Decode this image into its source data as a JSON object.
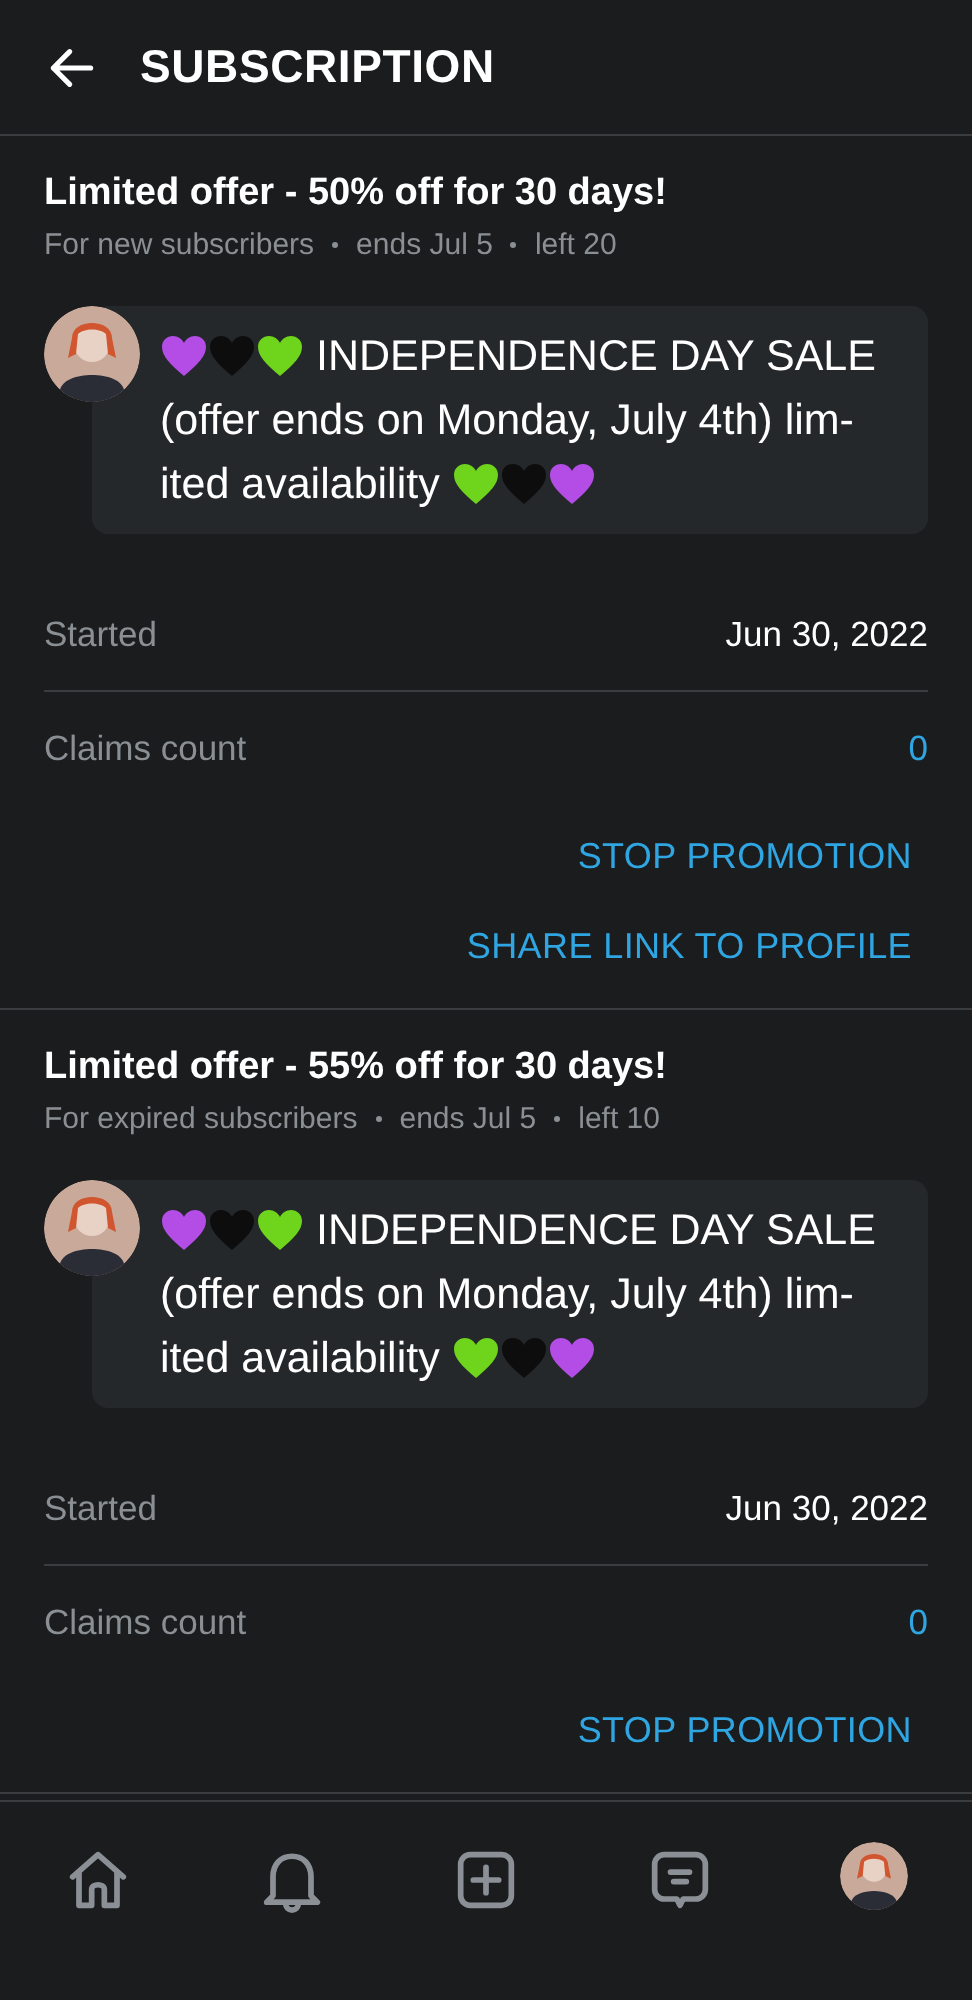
{
  "header": {
    "title": "SUBSCRIPTION"
  },
  "offers": [
    {
      "title": "Limited offer - 50% off for 30 days!",
      "meta": [
        "For new subscribers",
        "ends Jul 5",
        "left 20"
      ],
      "message": {
        "lead_hearts": [
          {
            "color": "#b34de6"
          },
          {
            "color": "#0d0d0d"
          },
          {
            "color": "#6fd41c"
          }
        ],
        "text": "INDEPENDENCE DAY SALE (offer ends on Monday, July 4th) lim-ited availability",
        "trail_hearts": [
          {
            "color": "#6fd41c"
          },
          {
            "color": "#0d0d0d"
          },
          {
            "color": "#b34de6"
          }
        ]
      },
      "rows": [
        {
          "label": "Started",
          "value": "Jun 30, 2022",
          "kind": "plain"
        },
        {
          "label": "Claims count",
          "value": "0",
          "kind": "link"
        }
      ],
      "actions": [
        "STOP PROMOTION",
        "SHARE LINK TO PROFILE"
      ]
    },
    {
      "title": "Limited offer - 55% off for 30 days!",
      "meta": [
        "For expired subscribers",
        "ends Jul 5",
        "left 10"
      ],
      "message": {
        "lead_hearts": [
          {
            "color": "#b34de6"
          },
          {
            "color": "#0d0d0d"
          },
          {
            "color": "#6fd41c"
          }
        ],
        "text": "INDEPENDENCE DAY SALE (offer ends on Monday, July 4th) lim-ited availability",
        "trail_hearts": [
          {
            "color": "#6fd41c"
          },
          {
            "color": "#0d0d0d"
          },
          {
            "color": "#b34de6"
          }
        ]
      },
      "rows": [
        {
          "label": "Started",
          "value": "Jun 30, 2022",
          "kind": "plain"
        },
        {
          "label": "Claims count",
          "value": "0",
          "kind": "link"
        }
      ],
      "actions": [
        "STOP PROMOTION"
      ]
    }
  ],
  "nav": [
    {
      "kind": "home"
    },
    {
      "kind": "bell"
    },
    {
      "kind": "plus"
    },
    {
      "kind": "messages"
    },
    {
      "kind": "avatar"
    }
  ]
}
